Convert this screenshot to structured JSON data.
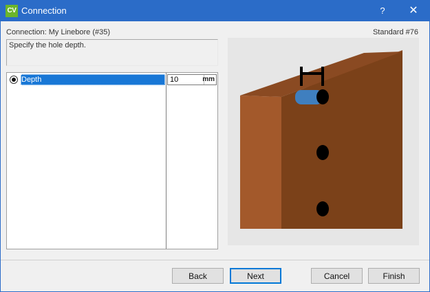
{
  "window": {
    "app_icon_text": "CV",
    "title": "Connection",
    "help_glyph": "?",
    "close_glyph": "✕"
  },
  "header": {
    "connection_label": "Connection: My Linebore (#35)",
    "standard_label": "Standard #76"
  },
  "description": "Specify the hole depth.",
  "properties": [
    {
      "name": "Depth",
      "value": "10",
      "unit": "mm",
      "selected": true
    }
  ],
  "preview": {
    "icon": "linebore-depth-diagram",
    "board_colors": {
      "top": "#8a4a22",
      "front": "#7b4119",
      "side": "#a3592b"
    },
    "dowel_color": "#3f7fbf",
    "hole_color": "#000000"
  },
  "buttons": {
    "back": "Back",
    "next": "Next",
    "cancel": "Cancel",
    "finish": "Finish"
  }
}
